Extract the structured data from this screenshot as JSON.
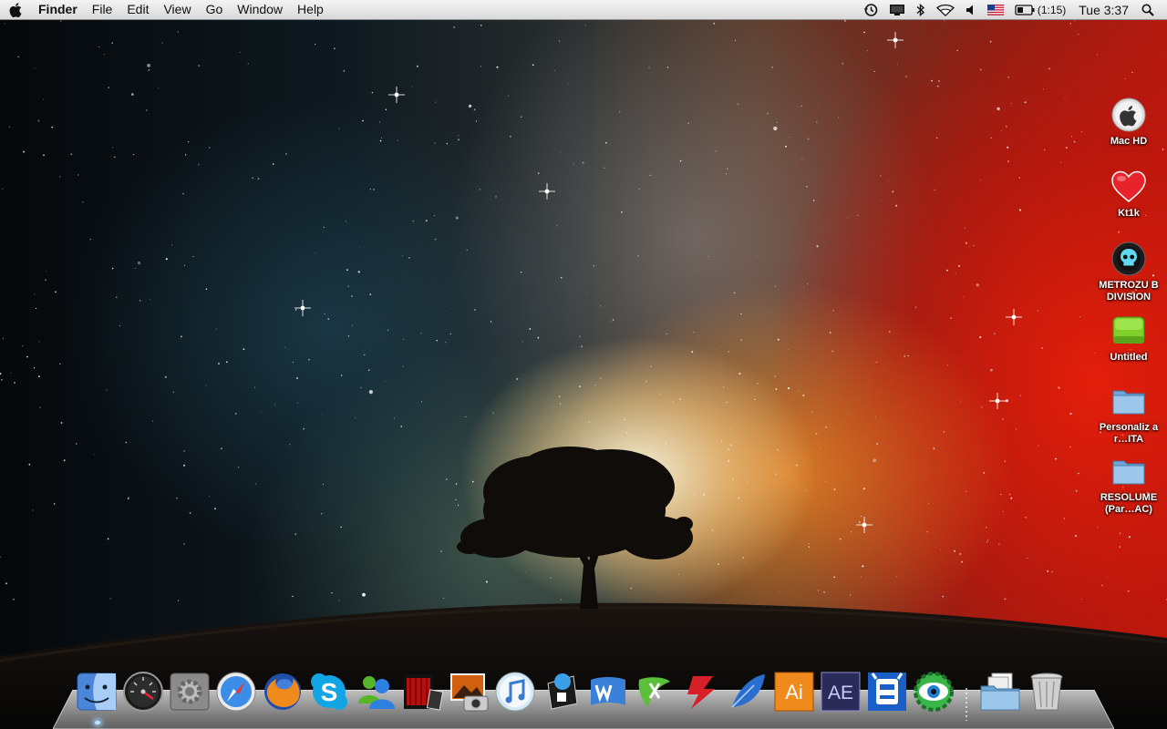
{
  "menubar": {
    "app_name": "Finder",
    "menus": [
      "File",
      "Edit",
      "View",
      "Go",
      "Window",
      "Help"
    ],
    "battery_time": "(1:15)",
    "clock": "Tue 3:37",
    "status_icons": [
      "time-machine-icon",
      "display-icon",
      "bluetooth-icon",
      "wifi-icon",
      "volume-icon",
      "us-flag-input-icon",
      "battery-icon",
      "spotlight-search-icon"
    ]
  },
  "desktop": {
    "icons": [
      {
        "label": "Mac HD",
        "icon": "apple-drive-icon"
      },
      {
        "label": "Kt1k",
        "icon": "heart-icon"
      },
      {
        "label": "METROZU BDIVISION",
        "icon": "skull-disc-icon"
      },
      {
        "label": "Untitled",
        "icon": "green-drive-icon"
      },
      {
        "label": "Personaliz ar…ITA",
        "icon": "folder-icon"
      },
      {
        "label": "RESOLUME (Par…AC)",
        "icon": "folder-icon"
      }
    ]
  },
  "dock": {
    "apps": [
      {
        "name": "finder-icon"
      },
      {
        "name": "dashboard-icon"
      },
      {
        "name": "system-preferences-icon"
      },
      {
        "name": "safari-icon"
      },
      {
        "name": "firefox-icon"
      },
      {
        "name": "skype-icon"
      },
      {
        "name": "messenger-icon"
      },
      {
        "name": "front-row-icon"
      },
      {
        "name": "image-capture-icon"
      },
      {
        "name": "itunes-icon"
      },
      {
        "name": "app-icon"
      },
      {
        "name": "word-icon"
      },
      {
        "name": "excel-icon"
      },
      {
        "name": "flash-icon"
      },
      {
        "name": "feather-icon"
      },
      {
        "name": "illustrator-icon",
        "text": "Ai"
      },
      {
        "name": "after-effects-icon",
        "text": "AE"
      },
      {
        "name": "robot-app-icon"
      },
      {
        "name": "eye-app-icon"
      }
    ],
    "stack": "documents-stack-icon",
    "trash": "trash-icon"
  },
  "colors": {
    "menubar_top": "#f4f4f4",
    "menubar_bottom": "#d9d9d9",
    "illustrator_bg": "#f08a1c",
    "after_effects_bg": "#2b2b5a",
    "skype_blue": "#12a5e6",
    "heart_red": "#e8232b",
    "drive_green": "#7fd02a"
  }
}
